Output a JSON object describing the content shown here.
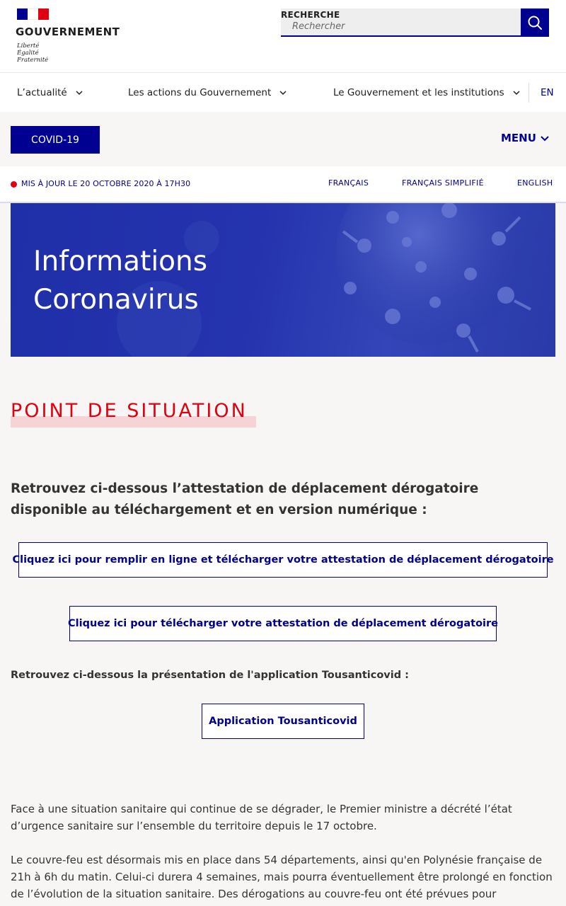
{
  "header": {
    "gov_name": "GOUVERNEMENT",
    "motto": [
      "Liberté",
      "Égalité",
      "Fraternité"
    ],
    "search_label": "RECHERCHE",
    "search_placeholder": "Rechercher",
    "brand_color": "#000091",
    "accent_red": "#e1000f"
  },
  "nav": {
    "items": [
      {
        "label": "L’actualité"
      },
      {
        "label": "Les actions du Gouvernement"
      },
      {
        "label": "Le Gouvernement et les institutions"
      }
    ],
    "lang": "EN"
  },
  "subnav": {
    "covid_label": "COVID-19",
    "menu_label": "MENU"
  },
  "update": {
    "text": "MIS À JOUR LE 20 OCTOBRE 2020 À 17H30",
    "languages": [
      "FRANÇAIS",
      "FRANÇAIS SIMPLIFIÉ",
      "ENGLISH"
    ]
  },
  "hero": {
    "title_line1": "Informations",
    "title_line2": "Coronavirus"
  },
  "main": {
    "section_title": "POINT DE SITUATION",
    "lead": "Retrouvez ci-dessous l’attestation de déplacement dérogatoire disponible au téléchargement et en version numérique :",
    "link_fill_online": "Cliquez ici pour remplir en ligne et télécharger votre attestation de déplacement dérogatoire",
    "link_download": "Cliquez ici pour télécharger votre attestation de déplacement dérogatoire",
    "app_intro": "Retrouvez ci-dessous la présentation de l'application Tousanticovid :",
    "link_app": "Application Tousanticovid",
    "paragraph1": "Face à une situation sanitaire qui continue de se dégrader, le Premier ministre a décrété l’état d’urgence sanitaire sur l’ensemble du territoire depuis le 17 octobre.",
    "paragraph2": "Le couvre-feu est désormais mis en place dans 54 départements, ainsi qu'en Polynésie française de 21h à 6h du matin. Celui-ci durera 4 semaines, mais pourra éventuellement être prolongé en fonction de l’évolution de la situation sanitaire. Des dérogations au couvre-feu ont été prévues pour"
  }
}
